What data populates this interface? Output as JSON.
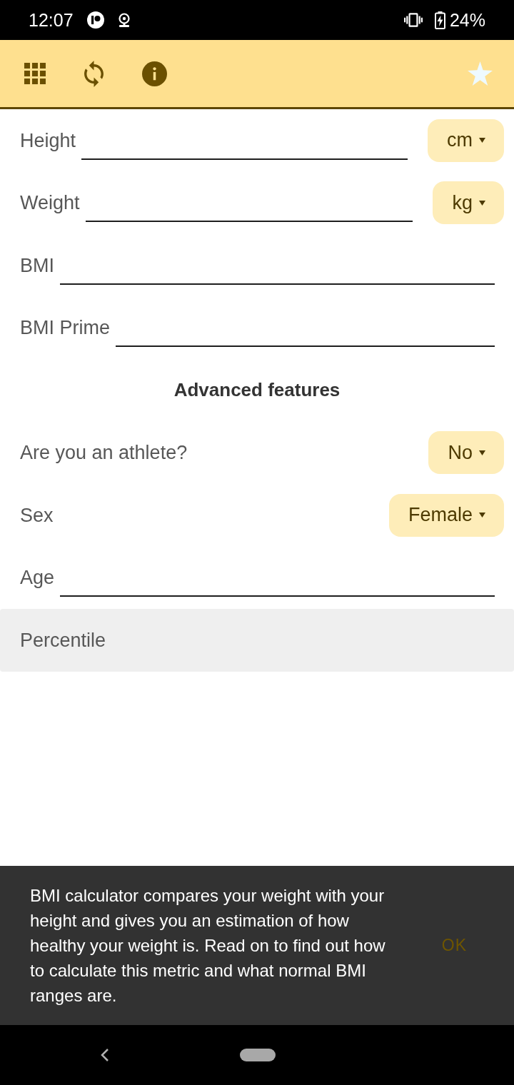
{
  "status_bar": {
    "time": "12:07",
    "battery": "24%"
  },
  "form": {
    "rows": [
      {
        "kind": "input",
        "label": "Height",
        "unit": "cm"
      },
      {
        "kind": "input",
        "label": "Weight",
        "unit": "kg"
      },
      {
        "kind": "input",
        "label": "BMI"
      },
      {
        "kind": "input",
        "label": "BMI Prime"
      }
    ]
  },
  "advanced": {
    "title": "Advanced features",
    "rows": [
      {
        "kind": "select",
        "label": "Are you an athlete?",
        "value": "No"
      },
      {
        "kind": "select",
        "label": "Sex",
        "value": "Female"
      },
      {
        "kind": "input",
        "label": "Age"
      },
      {
        "kind": "result",
        "label": "Percentile"
      }
    ]
  },
  "snackbar": {
    "message": "BMI calculator compares your weight with your height and gives you an estimation of how healthy your weight is. Read on to find out how to calculate this metric and what normal BMI ranges are.",
    "action": "OK"
  }
}
